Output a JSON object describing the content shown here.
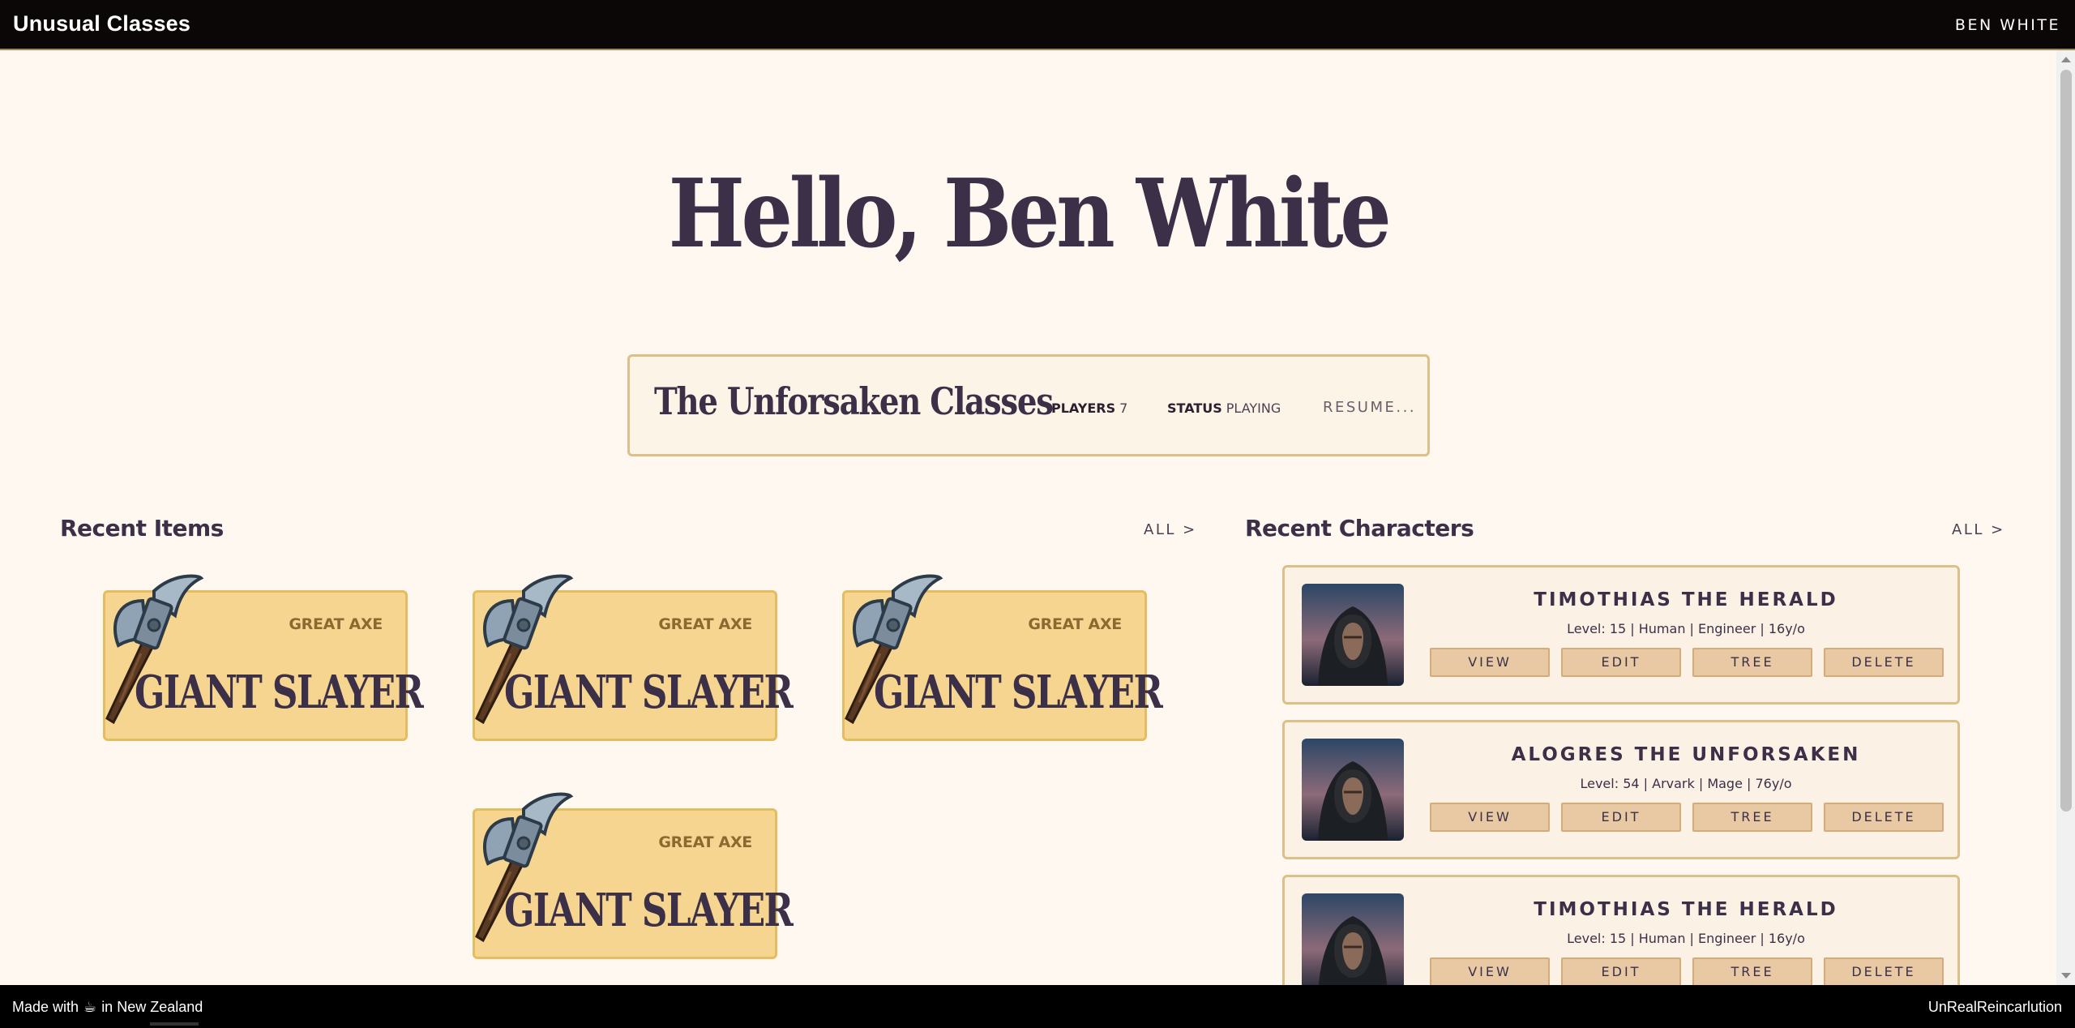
{
  "app": {
    "brand": "Unusual Classes",
    "user": "BEN WHITE"
  },
  "hero": {
    "greeting": "Hello, Ben White"
  },
  "game": {
    "title": "The Unforsaken Classes",
    "players_label": "PLAYERS",
    "players_value": "7",
    "status_label": "STATUS",
    "status_value": "PLAYING",
    "resume_label": "RESUME..."
  },
  "recent_items": {
    "title": "Recent Items",
    "all_label": "ALL >",
    "items": [
      {
        "type": "GREAT AXE",
        "name": "GIANT SLAYER",
        "icon": "great-axe-icon"
      },
      {
        "type": "GREAT AXE",
        "name": "GIANT SLAYER",
        "icon": "great-axe-icon"
      },
      {
        "type": "GREAT AXE",
        "name": "GIANT SLAYER",
        "icon": "great-axe-icon"
      },
      {
        "type": "GREAT AXE",
        "name": "GIANT SLAYER",
        "icon": "great-axe-icon"
      }
    ]
  },
  "recent_characters": {
    "title": "Recent Characters",
    "all_label": "ALL >",
    "buttons": {
      "view": "VIEW",
      "edit": "EDIT",
      "tree": "TREE",
      "delete": "DELETE"
    },
    "characters": [
      {
        "name": "TIMOTHIAS THE HERALD",
        "info": "Level: 15 | Human | Engineer | 16y/o"
      },
      {
        "name": "ALOGRES THE UNFORSAKEN",
        "info": "Level: 54 | Arvark | Mage | 76y/o"
      },
      {
        "name": "TIMOTHIAS THE HERALD",
        "info": "Level: 15 | Human | Engineer | 16y/o"
      }
    ]
  },
  "footer": {
    "made_with": "Made with",
    "cup_icon": "coffee-cup-icon",
    "location": "in New Zealand",
    "credit": "UnRealReincarlution"
  }
}
